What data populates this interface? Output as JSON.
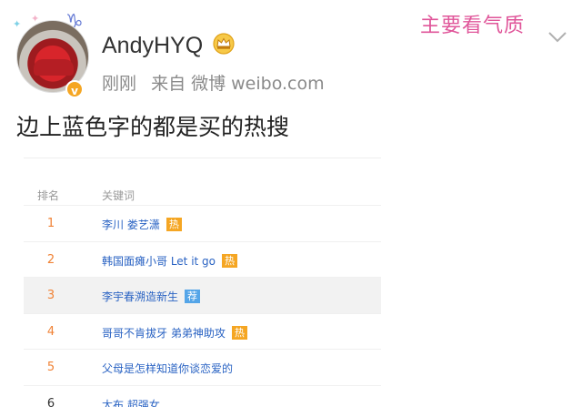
{
  "post": {
    "username": "AndyHYQ",
    "time": "刚刚",
    "source": "来自 微博 weibo.com",
    "text": "边上蓝色字的都是买的热搜",
    "watermark": "主要看气质",
    "crown_icon": "crown-icon",
    "verified_icon": "verified-badge-icon",
    "more_icon": "chevron-down-icon"
  },
  "hot_table": {
    "header_rank": "排名",
    "header_keyword": "关键词",
    "rows": [
      {
        "rank": "1",
        "keyword": "李川 娄艺潇",
        "tag": "热",
        "tag_type": "hot"
      },
      {
        "rank": "2",
        "keyword": "韩国面瘫小哥 Let it go",
        "tag": "热",
        "tag_type": "hot"
      },
      {
        "rank": "3",
        "keyword": "李宇春溯造新生",
        "tag": "荐",
        "tag_type": "rec"
      },
      {
        "rank": "4",
        "keyword": "哥哥不肯拔牙 弟弟神助攻",
        "tag": "热",
        "tag_type": "hot"
      },
      {
        "rank": "5",
        "keyword": "父母是怎样知道你谈恋爱的",
        "tag": "",
        "tag_type": ""
      },
      {
        "rank": "6",
        "keyword": "太布 超强女",
        "tag": "",
        "tag_type": ""
      }
    ]
  },
  "colors": {
    "rank": "#f08235",
    "keyword": "#2a63c3",
    "hot_tag": "#f5a623",
    "rec_tag": "#54a5e8",
    "watermark": "#e0569a"
  }
}
